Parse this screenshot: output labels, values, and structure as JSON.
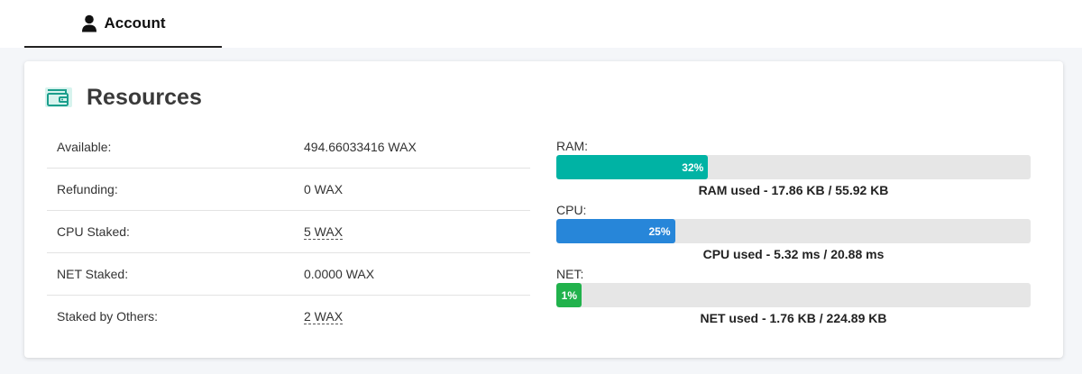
{
  "tabs": [
    {
      "label": "Account",
      "active": true,
      "icon": "user-icon"
    }
  ],
  "resources": {
    "title": "Resources",
    "icon": "wallet-icon",
    "rows": [
      {
        "label": "Available:",
        "value": "494.66033416 WAX"
      },
      {
        "label": "Refunding:",
        "value": "0 WAX"
      },
      {
        "label": "CPU Staked:",
        "value": "5 WAX"
      },
      {
        "label": "NET Staked:",
        "value": "0.0000 WAX"
      },
      {
        "label": "Staked by Others:",
        "value": "2 WAX"
      }
    ],
    "meters": [
      {
        "name": "RAM:",
        "percent_label": "32%",
        "percent": 32,
        "color": "#00b3a4",
        "caption": "RAM used - 17.86 KB / 55.92 KB"
      },
      {
        "name": "CPU:",
        "percent_label": "25%",
        "percent": 25,
        "color": "#2786d9",
        "caption": "CPU used - 5.32 ms / 20.88 ms"
      },
      {
        "name": "NET:",
        "percent_label": "1%",
        "percent": 1,
        "color": "#21b24c",
        "caption": "NET used - 1.76 KB / 224.89 KB"
      }
    ]
  }
}
